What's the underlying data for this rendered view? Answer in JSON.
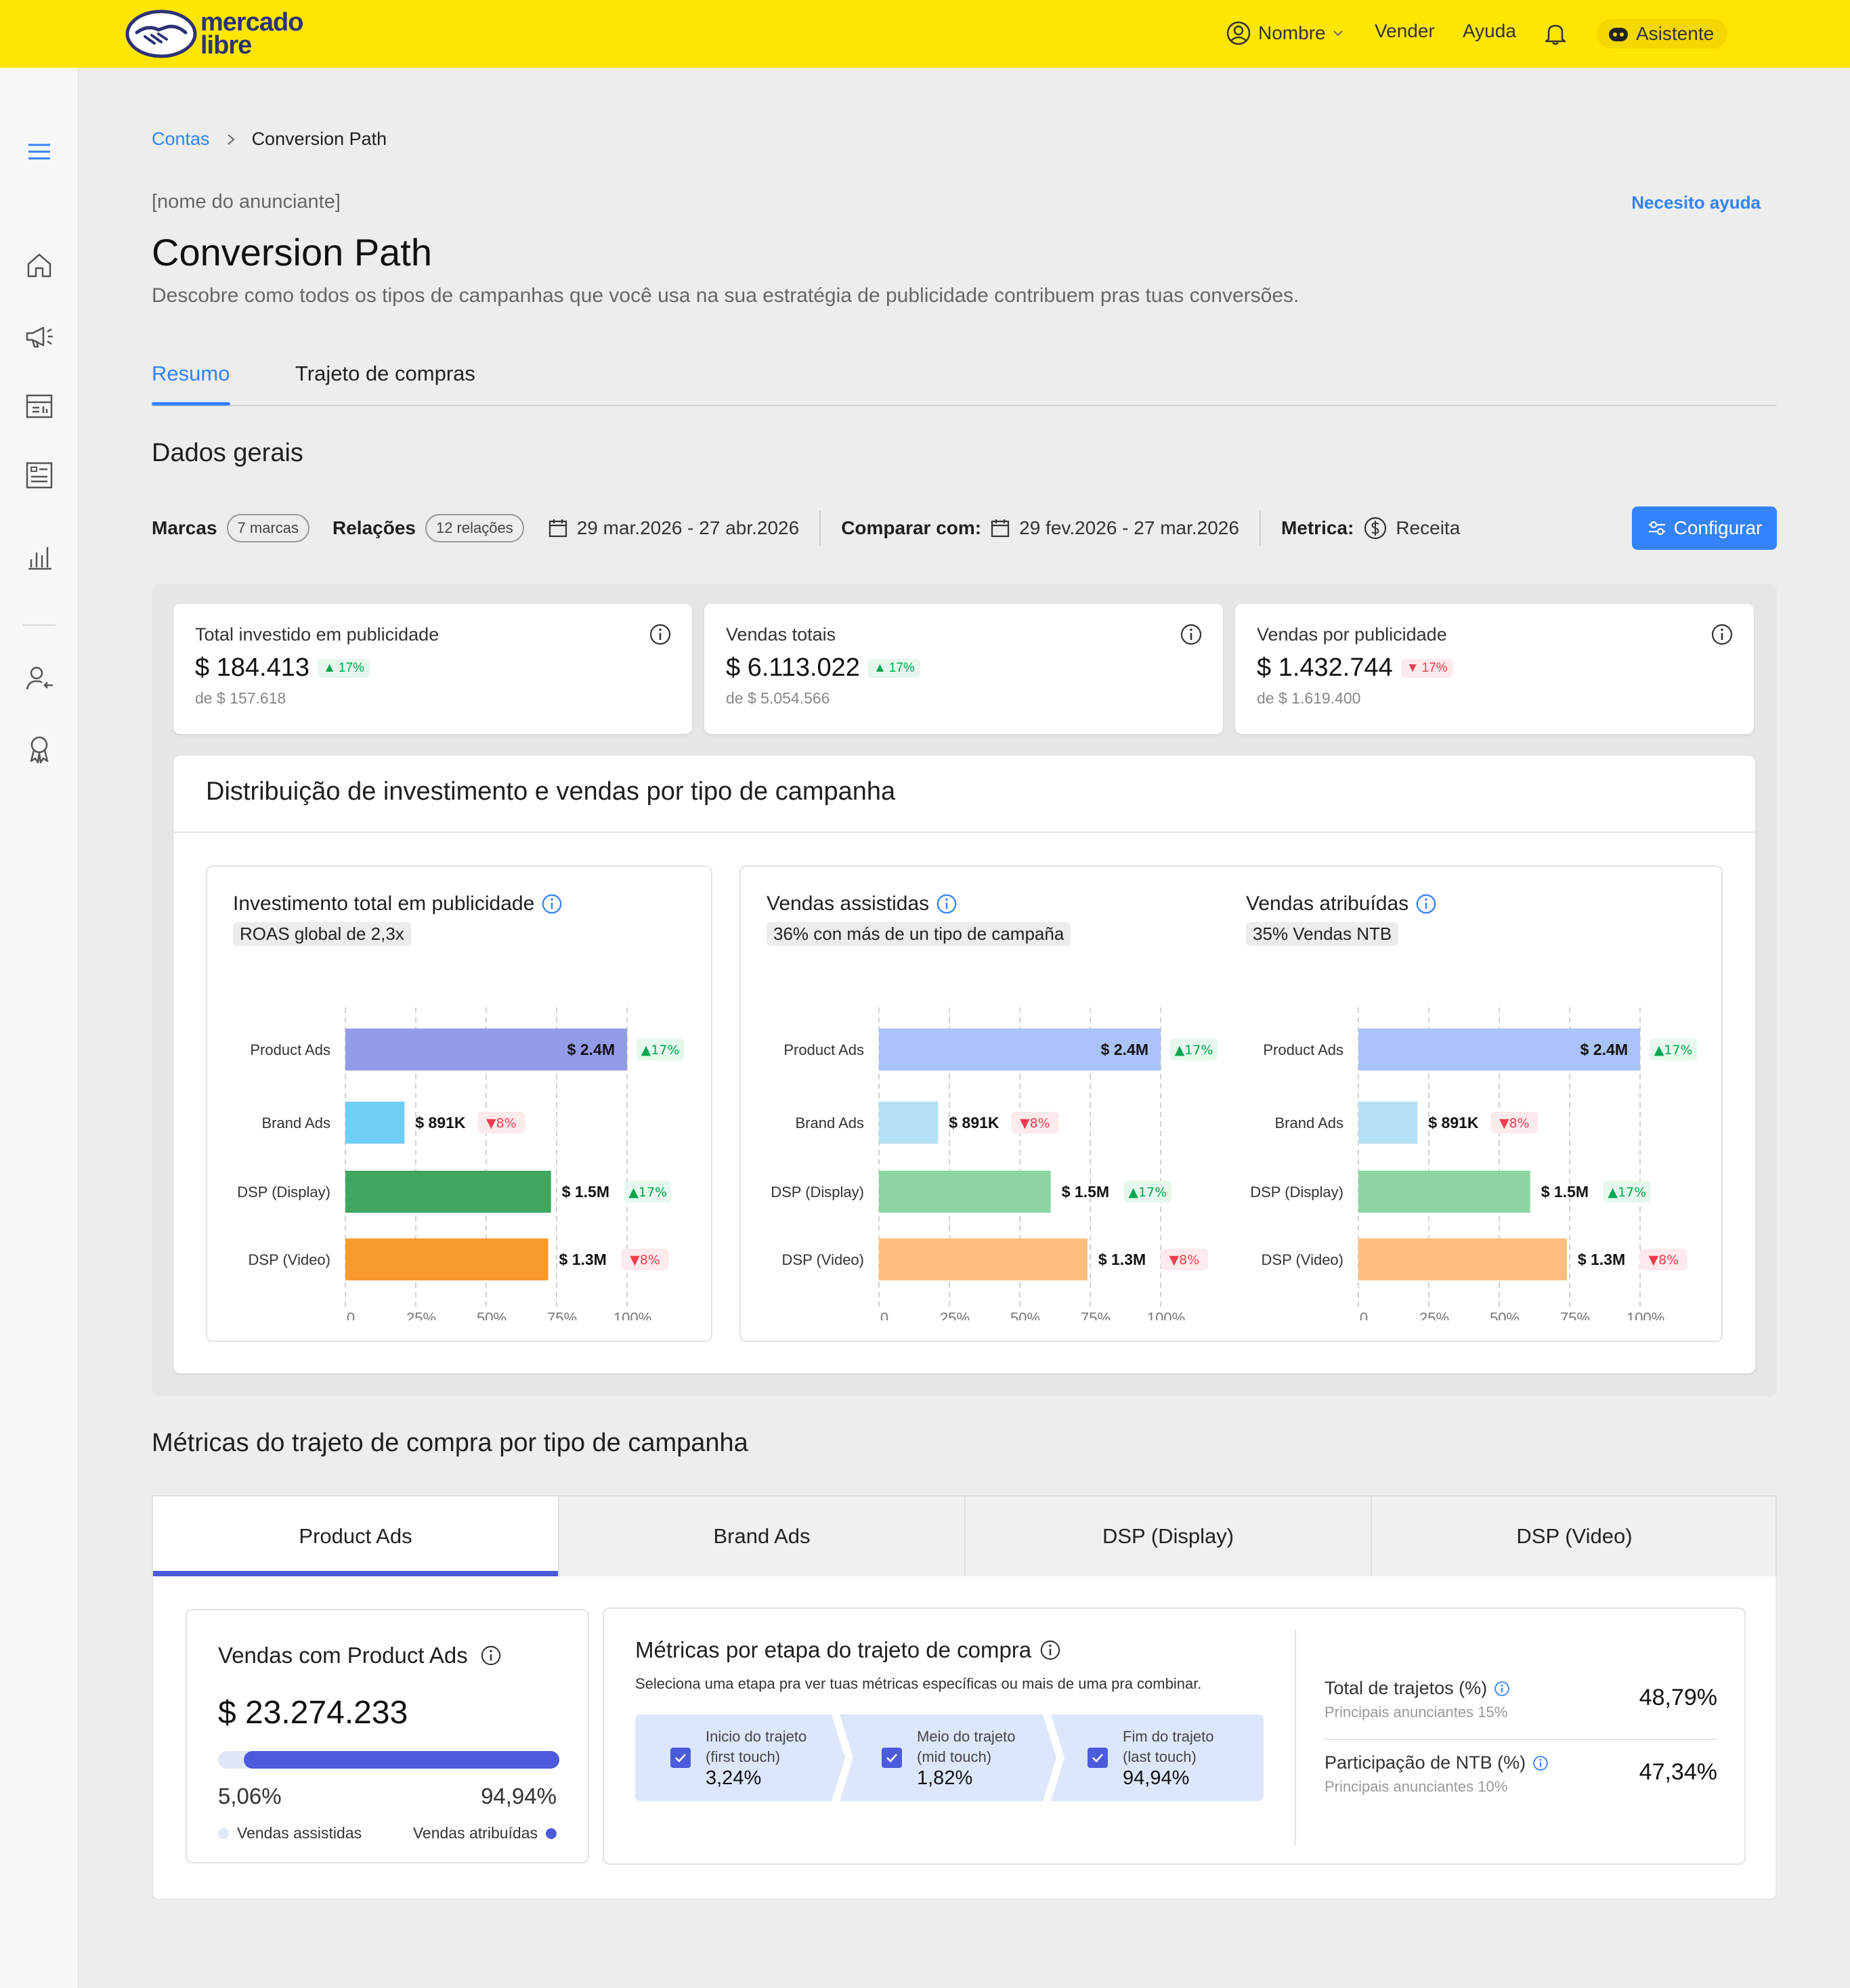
{
  "header": {
    "logo_line1": "mercado",
    "logo_line2": "libre",
    "user": "Nombre",
    "vender": "Vender",
    "ayuda": "Ayuda",
    "asistente": "Asistente"
  },
  "breadcrumb": {
    "root": "Contas",
    "current": "Conversion Path"
  },
  "page": {
    "advertiser": "[nome do anunciante]",
    "help": "Necesito ayuda",
    "title": "Conversion Path",
    "description": "Descobre como todos os tipos de campanhas que você usa na sua estratégia de publicidade contribuem pras tuas conversões."
  },
  "tabs": {
    "resumo": "Resumo",
    "trajeto": "Trajeto de compras"
  },
  "overview": {
    "title": "Dados gerais",
    "marcas_label": "Marcas",
    "marcas_chip": "7 marcas",
    "relacoes_label": "Relações",
    "relacoes_chip": "12 relações",
    "date_range": "29 mar.2026 - 27 abr.2026",
    "compare_label": "Comparar com:",
    "compare_range": "29 fev.2026 - 27 mar.2026",
    "metrica_label": "Metrica:",
    "metrica_value": "Receita",
    "configurar": "Configurar"
  },
  "kpis": [
    {
      "label": "Total investido em publicidade",
      "value": "$ 184.413",
      "delta": "17%",
      "direction": "up",
      "previous": "de $ 157.618"
    },
    {
      "label": "Vendas totais",
      "value": "$ 6.113.022",
      "delta": "17%",
      "direction": "up",
      "previous": "de $ 5.054.566"
    },
    {
      "label": "Vendas por publicidade",
      "value": "$ 1.432.744",
      "delta": "17%",
      "direction": "down",
      "previous": "de $ 1.619.400"
    }
  ],
  "distribution": {
    "title": "Distribuição de investimento e vendas por tipo de campanha",
    "charts": [
      {
        "title": "Investimento total em publicidade",
        "subtitle": "ROAS global de 2,3x"
      },
      {
        "title": "Vendas assistidas",
        "subtitle": "36% con más de un tipo de campaña"
      },
      {
        "title": "Vendas atribuídas",
        "subtitle": "35% Vendas NTB"
      }
    ]
  },
  "chart_data": [
    {
      "type": "bar",
      "orientation": "horizontal",
      "title": "Investimento total em publicidade",
      "categories": [
        "Product Ads",
        "Brand Ads",
        "DSP (Display)",
        "DSP (Video)"
      ],
      "values_pct": [
        100,
        21,
        73,
        72
      ],
      "value_labels": [
        "$ 2.4M",
        "$ 891K",
        "$ 1.5M",
        "$ 1.3M"
      ],
      "deltas": [
        {
          "v": "17%",
          "d": "up"
        },
        {
          "v": "8%",
          "d": "down"
        },
        {
          "v": "17%",
          "d": "up"
        },
        {
          "v": "8%",
          "d": "down"
        }
      ],
      "colors": [
        "#949be8",
        "#6fcdf6",
        "#3fa75f",
        "#f99a2e"
      ],
      "xticks": [
        "0",
        "25%",
        "50%",
        "75%",
        "100%"
      ],
      "xlim": [
        0,
        100
      ]
    },
    {
      "type": "bar",
      "orientation": "horizontal",
      "title": "Vendas assistidas",
      "categories": [
        "Product Ads",
        "Brand Ads",
        "DSP (Display)",
        "DSP (Video)"
      ],
      "values_pct": [
        100,
        21,
        61,
        74
      ],
      "value_labels": [
        "$ 2.4M",
        "$ 891K",
        "$ 1.5M",
        "$ 1.3M"
      ],
      "deltas": [
        {
          "v": "17%",
          "d": "up"
        },
        {
          "v": "8%",
          "d": "down"
        },
        {
          "v": "17%",
          "d": "up"
        },
        {
          "v": "8%",
          "d": "down"
        }
      ],
      "colors": [
        "#aac3f8",
        "#b6e1f4",
        "#8dd5a2",
        "#fdbd7c"
      ],
      "xticks": [
        "0",
        "25%",
        "50%",
        "75%",
        "100%"
      ],
      "xlim": [
        0,
        100
      ]
    },
    {
      "type": "bar",
      "orientation": "horizontal",
      "title": "Vendas atribuídas",
      "categories": [
        "Product Ads",
        "Brand Ads",
        "DSP (Display)",
        "DSP (Video)"
      ],
      "values_pct": [
        100,
        21,
        61,
        74
      ],
      "value_labels": [
        "$ 2.4M",
        "$ 891K",
        "$ 1.5M",
        "$ 1.3M"
      ],
      "deltas": [
        {
          "v": "17%",
          "d": "up"
        },
        {
          "v": "8%",
          "d": "down"
        },
        {
          "v": "17%",
          "d": "up"
        },
        {
          "v": "8%",
          "d": "down"
        }
      ],
      "colors": [
        "#aac3f8",
        "#b6e1f4",
        "#8dd5a2",
        "#fdbd7c"
      ],
      "xticks": [
        "0",
        "25%",
        "50%",
        "75%",
        "100%"
      ],
      "xlim": [
        0,
        100
      ]
    }
  ],
  "section2": {
    "title": "Métricas do trajeto de compra por tipo de campanha",
    "tabs": [
      "Product Ads",
      "Brand Ads",
      "DSP (Display)",
      "DSP (Video)"
    ]
  },
  "product_ads": {
    "title": "Vendas com Product Ads",
    "value": "$ 23.274.233",
    "assisted_pct": "5,06%",
    "attributed_pct": "94,94%",
    "assisted_fraction": 0.0506,
    "assisted_label": "Vendas assistidas",
    "attributed_label": "Vendas atribuídas"
  },
  "journey": {
    "title": "Métricas por etapa do trajeto de compra",
    "subtitle": "Seleciona uma etapa pra ver tuas métricas específicas ou mais de uma pra combinar.",
    "steps": [
      {
        "line1": "Inicio do trajeto",
        "line2": "(first touch)",
        "value": "3,24%"
      },
      {
        "line1": "Meio do trajeto",
        "line2": "(mid touch)",
        "value": "1,82%"
      },
      {
        "line1": "Fim do trajeto",
        "line2": "(last touch)",
        "value": "94,94%"
      }
    ],
    "metrics": [
      {
        "label": "Total de trajetos (%)",
        "sub": "Principais anunciantes 15%",
        "value": "48,79%"
      },
      {
        "label": "Participação de NTB (%)",
        "sub": "Principais anunciantes 10%",
        "value": "47,34%"
      }
    ]
  },
  "colors": {
    "brand_yellow": "#ffe600",
    "primary_blue": "#3483fa",
    "accent_indigo": "#4b5bdc",
    "positive": "#00a650",
    "negative": "#f23d4f"
  }
}
